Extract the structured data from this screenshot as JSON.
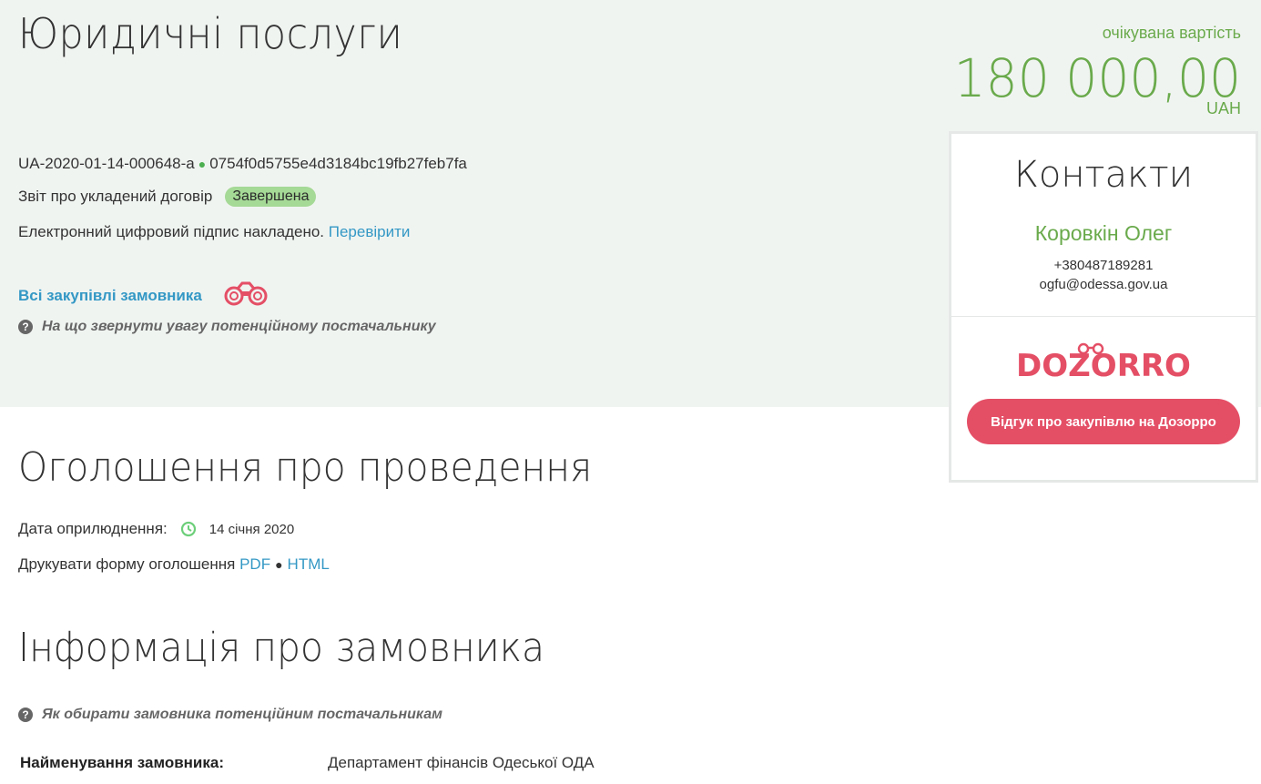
{
  "header": {
    "title": "Юридичні послуги",
    "expected_label": "очікувана вартість",
    "amount": "180 000,00",
    "currency": "UAH"
  },
  "tender": {
    "id": "UA-2020-01-14-000648-a",
    "hash": "0754f0d5755e4d3184bc19fb27feb7fa",
    "report_label": "Звіт про укладений договір",
    "status": "Завершена",
    "signature_text": "Електронний цифровий підпис накладено.",
    "verify_link": "Перевірити",
    "all_purchases_link": "Всі закупівлі замовника",
    "hint_supplier": "На що звернути увагу потенційному постачальнику"
  },
  "contacts": {
    "title": "Контакти",
    "name": "Коровкін Олег",
    "phone": "+380487189281",
    "email": "ogfu@odessa.gov.ua",
    "logo_text": "DOZORRO",
    "review_button": "Відгук про закупівлю на Дозорро"
  },
  "announcement": {
    "title": "Оголошення про проведення",
    "date_label": "Дата оприлюднення:",
    "date_value": "14 січня 2020",
    "print_label": "Друкувати форму оголошення",
    "pdf_link": "PDF",
    "html_link": "HTML"
  },
  "customer": {
    "title": "Інформація про замовника",
    "hint": "Як обирати замовника потенційним постачальникам",
    "name_label": "Найменування замовника:",
    "name_value": "Департамент фінансів Одеської ОДА"
  },
  "colors": {
    "accent_green": "#6aaa4c",
    "link_blue": "#3498c5",
    "dozorro_red": "#e44f66",
    "band_bg": "#f0f4f1"
  }
}
